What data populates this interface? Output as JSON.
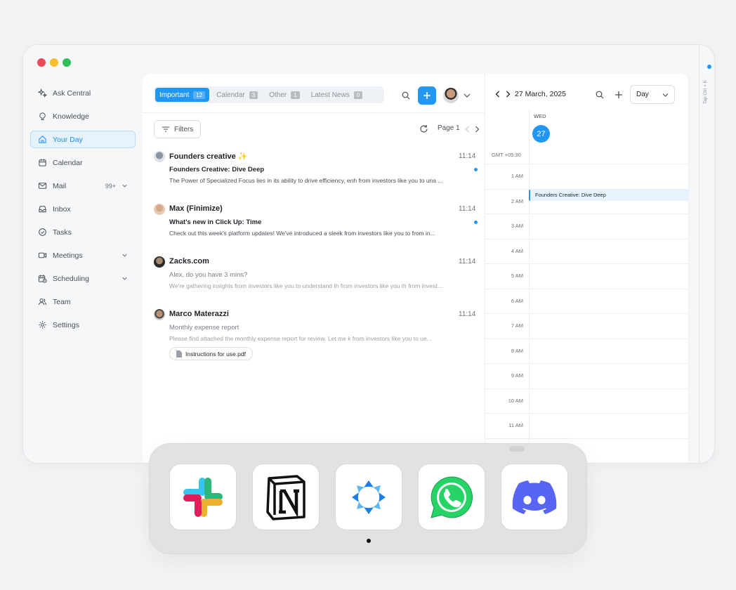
{
  "colors": {
    "accent": "#2196f3",
    "traffic_red": "#ee4b5a",
    "traffic_yellow": "#f5bf2e",
    "traffic_green": "#31bf5b"
  },
  "sidebar": {
    "items": [
      {
        "label": "Ask Central",
        "icon": "sparkle-icon"
      },
      {
        "label": "Knowledge",
        "icon": "lightbulb-icon"
      },
      {
        "label": "Your Day",
        "icon": "home-icon",
        "active": true
      },
      {
        "label": "Calendar",
        "icon": "calendar-icon"
      },
      {
        "label": "Mail",
        "icon": "mail-icon",
        "badge": "99+"
      },
      {
        "label": "Inbox",
        "icon": "inbox-icon"
      },
      {
        "label": "Tasks",
        "icon": "check-circle-icon"
      },
      {
        "label": "Meetings",
        "icon": "video-icon"
      },
      {
        "label": "Scheduling",
        "icon": "calendar-clock-icon"
      },
      {
        "label": "Team",
        "icon": "team-icon"
      },
      {
        "label": "Settings",
        "icon": "gear-icon"
      }
    ]
  },
  "tabs": [
    {
      "label": "Important",
      "count": "12",
      "active": true
    },
    {
      "label": "Calendar",
      "count": "3"
    },
    {
      "label": "Other",
      "count": "1"
    },
    {
      "label": "Latest News",
      "count": "0"
    }
  ],
  "toolbar": {
    "filters_label": "Filters",
    "page_label": "Page 1"
  },
  "mails": [
    {
      "sender": "Founders creative",
      "time": "11:14",
      "subject": "Founders Creative: Dive Deep",
      "preview": "The Power of Specialized Focus lies in its ability to drive efficiency, enh from investors like you to una ...",
      "unread": true
    },
    {
      "sender": "Max (Finimize)",
      "time": "11:14",
      "subject": "What's new in Click Up: Time",
      "preview": "Check out this week's platform updates! We've introduced a sleek  from investors like you to from in...",
      "unread": true
    },
    {
      "sender": "Zacks.com",
      "time": "11:14",
      "subject": "Alex, do you have 3 mins?",
      "preview": "We're gathering insights from investors like you to understand th  from investors like you  th  from invest...",
      "unread": false
    },
    {
      "sender": "Marco Materazzi",
      "time": "11:14",
      "subject": "Monthly expense report",
      "preview": "Please find attached the monthly expense report for review. Let me k from investors like you to ue...",
      "unread": false,
      "attachment": "Instructions for use.pdf"
    }
  ],
  "calendar": {
    "date": "27 March, 2025",
    "view": "Day",
    "weekday": "WED",
    "day": "27",
    "timezone": "GMT +05:30",
    "hours": [
      "1 AM",
      "2 AM",
      "3 AM",
      "4 AM",
      "5 AM",
      "6 AM",
      "7 AM",
      "8 AM",
      "9 AM",
      "10 AM",
      "11 AM"
    ],
    "event": "Founders Creative: Dive Deep"
  },
  "right_strip": {
    "shortcut": "Tap Ctrl + K"
  },
  "dock": {
    "apps": [
      "Slack",
      "Notion",
      "Central",
      "WhatsApp",
      "Discord"
    ],
    "icons": [
      "slack-icon",
      "notion-icon",
      "central-icon",
      "whatsapp-icon",
      "discord-icon"
    ]
  }
}
